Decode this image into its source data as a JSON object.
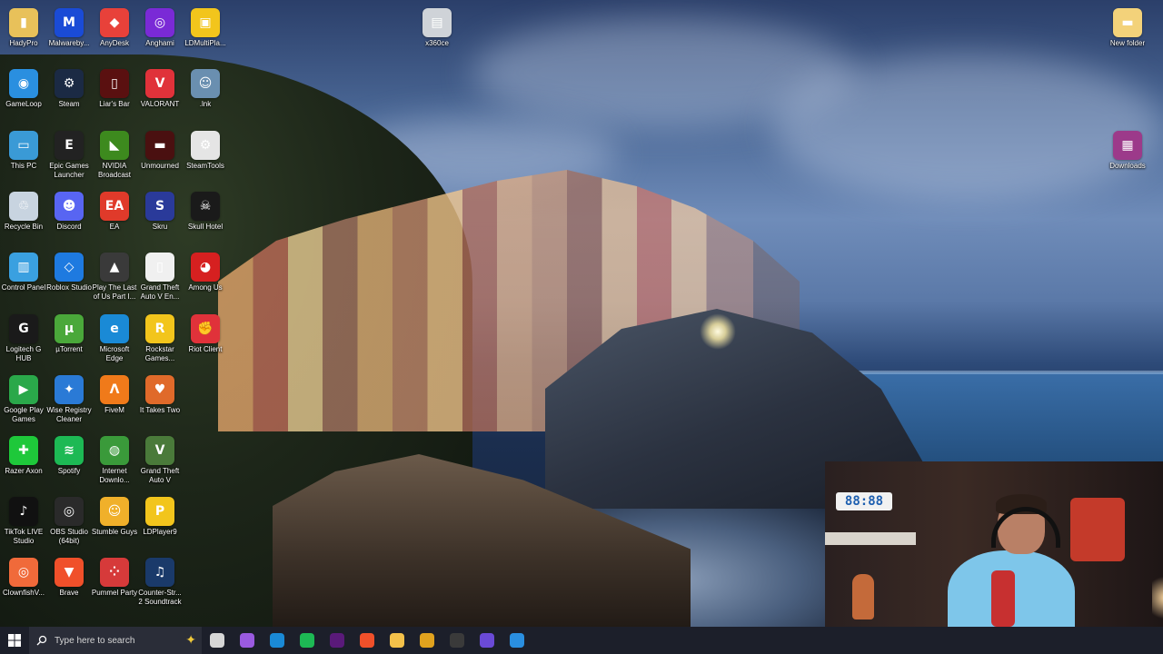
{
  "desktop": {
    "icons": [
      {
        "label": "HadyPro",
        "color": "#e8c15a",
        "glyph": "▮"
      },
      {
        "label": "Malwareby...",
        "color": "#1a4bd6",
        "glyph": "M"
      },
      {
        "label": "AnyDesk",
        "color": "#e8413a",
        "glyph": "◆"
      },
      {
        "label": "Anghami",
        "color": "#7a2ad6",
        "glyph": "◎"
      },
      {
        "label": "LDMultiPla...",
        "color": "#f2c51c",
        "glyph": "▣"
      },
      {
        "label": "x360ce",
        "color": "#cfd3d8",
        "glyph": "▤"
      },
      {
        "label": "New folder",
        "color": "#f3d27a",
        "glyph": "▬"
      },
      {
        "label": "GameLoop",
        "color": "#2a8fe0",
        "glyph": "◉"
      },
      {
        "label": "Steam",
        "color": "#1b2a44",
        "glyph": "⚙"
      },
      {
        "label": "Liar's Bar",
        "color": "#5a1010",
        "glyph": "▯"
      },
      {
        "label": "VALORANT",
        "color": "#e0323a",
        "glyph": "V"
      },
      {
        "label": ".lnk",
        "color": "#6a8fb0",
        "glyph": "☺"
      },
      {
        "label": "This PC",
        "color": "#3a9ad6",
        "glyph": "▭"
      },
      {
        "label": "Epic Games Launcher",
        "color": "#222222",
        "glyph": "E"
      },
      {
        "label": "NVIDIA Broadcast",
        "color": "#3d8a1e",
        "glyph": "◣"
      },
      {
        "label": "Unmourned",
        "color": "#4a1010",
        "glyph": "▬"
      },
      {
        "label": "SteamTools",
        "color": "#e5e5e5",
        "glyph": "⚙"
      },
      {
        "label": "Downloads",
        "color": "#9c3a8a",
        "glyph": "▦"
      },
      {
        "label": "Recycle Bin",
        "color": "#c8d4e0",
        "glyph": "♲"
      },
      {
        "label": "Discord",
        "color": "#5865f2",
        "glyph": "☻"
      },
      {
        "label": "EA",
        "color": "#e03a2a",
        "glyph": "EA"
      },
      {
        "label": "Skru",
        "color": "#2a3a9a",
        "glyph": "S"
      },
      {
        "label": "Skull Hotel",
        "color": "#1a1a1a",
        "glyph": "☠"
      },
      {
        "label": "Control Panel",
        "color": "#3aa0e0",
        "glyph": "▥"
      },
      {
        "label": "Roblox Studio",
        "color": "#1e7ae0",
        "glyph": "◇"
      },
      {
        "label": "Play The Last of Us Part I...",
        "color": "#3a3a3a",
        "glyph": "▲"
      },
      {
        "label": "Grand Theft Auto V En...",
        "color": "#f0f0f0",
        "glyph": "▯"
      },
      {
        "label": "Among Us",
        "color": "#d62020",
        "glyph": "◕"
      },
      {
        "label": "Logitech G HUB",
        "color": "#1a1a1a",
        "glyph": "G"
      },
      {
        "label": "µTorrent",
        "color": "#4aa83a",
        "glyph": "µ"
      },
      {
        "label": "Microsoft Edge",
        "color": "#1a8ad6",
        "glyph": "e"
      },
      {
        "label": "Rockstar Games...",
        "color": "#f2c51c",
        "glyph": "R"
      },
      {
        "label": "Riot Client",
        "color": "#e0323a",
        "glyph": "✊"
      },
      {
        "label": "Google Play Games",
        "color": "#2aa84a",
        "glyph": "▶"
      },
      {
        "label": "Wise Registry Cleaner",
        "color": "#2a7ad6",
        "glyph": "✦"
      },
      {
        "label": "FiveM",
        "color": "#f07a1a",
        "glyph": "Λ"
      },
      {
        "label": "It Takes Two",
        "color": "#e06a2a",
        "glyph": "♥"
      },
      {
        "label": "Razer Axon",
        "color": "#1ec83a",
        "glyph": "✚"
      },
      {
        "label": "Spotify",
        "color": "#1db954",
        "glyph": "≋"
      },
      {
        "label": "Internet Downlo...",
        "color": "#3a9a3a",
        "glyph": "◍"
      },
      {
        "label": "Grand Theft Auto V",
        "color": "#4a7a3a",
        "glyph": "V"
      },
      {
        "label": "TikTok LIVE Studio",
        "color": "#111111",
        "glyph": "♪"
      },
      {
        "label": "OBS Studio (64bit)",
        "color": "#2a2a2a",
        "glyph": "◎"
      },
      {
        "label": "Stumble Guys",
        "color": "#f0b02a",
        "glyph": "☺"
      },
      {
        "label": "LDPlayer9",
        "color": "#f2c51c",
        "glyph": "P"
      },
      {
        "label": "ClownfishV...",
        "color": "#f06a3a",
        "glyph": "◎"
      },
      {
        "label": "Brave",
        "color": "#f0502a",
        "glyph": "▼"
      },
      {
        "label": "Pummel Party",
        "color": "#d63a3a",
        "glyph": "⁘"
      },
      {
        "label": "Counter-Str... 2 Soundtrack",
        "color": "#1a3a6a",
        "glyph": "♫"
      }
    ]
  },
  "webcam": {
    "clock_text": "88:88"
  },
  "taskbar": {
    "search_placeholder": "Type here to search",
    "pinned": [
      {
        "name": "task-view",
        "color": "#d6d6d6"
      },
      {
        "name": "copilot",
        "color": "#9a5ae0"
      },
      {
        "name": "edge",
        "color": "#1a8ad6"
      },
      {
        "name": "spotify",
        "color": "#1db954"
      },
      {
        "name": "premiere",
        "color": "#5a1a7a"
      },
      {
        "name": "brave",
        "color": "#f0502a"
      },
      {
        "name": "file-explorer",
        "color": "#f3c14a"
      },
      {
        "name": "chrome",
        "color": "#e0a21e"
      },
      {
        "name": "obs",
        "color": "#3a3a3a"
      },
      {
        "name": "chrome-alt",
        "color": "#6a4ad6"
      },
      {
        "name": "gameloop",
        "color": "#2a8fe0"
      }
    ]
  }
}
